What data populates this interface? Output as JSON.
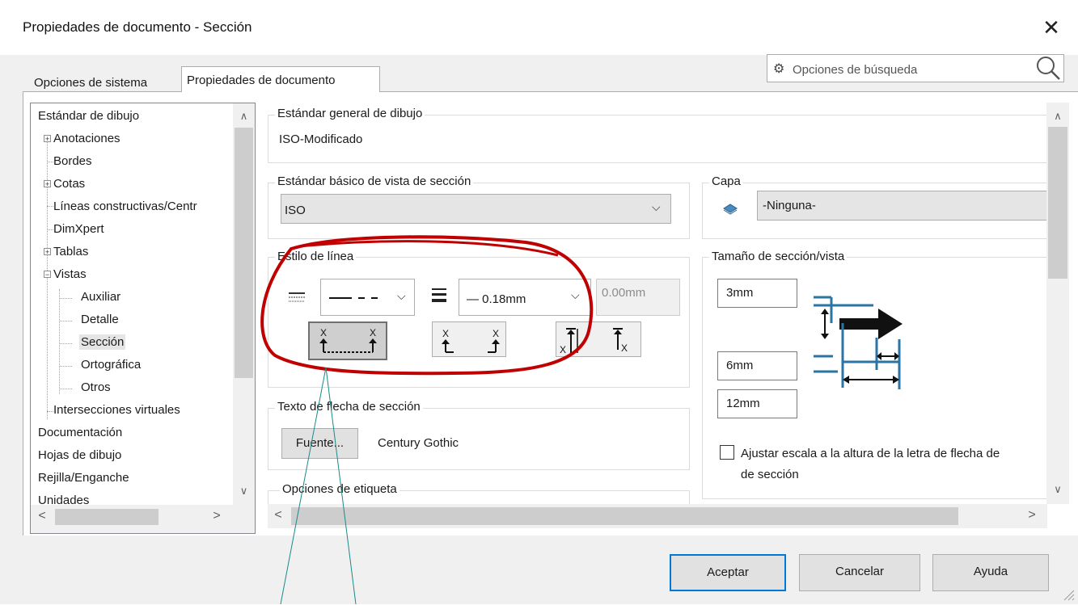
{
  "window": {
    "title": "Propiedades de documento - Sección",
    "close_label": "✕"
  },
  "search": {
    "placeholder": "Opciones de búsqueda"
  },
  "tabs": [
    {
      "label": "Opciones de sistema",
      "active": false
    },
    {
      "label": "Propiedades de documento",
      "active": true
    }
  ],
  "tree": {
    "items": [
      {
        "label": "Estándar de dibujo",
        "expander": ""
      },
      {
        "label": "Anotaciones",
        "expander": "+"
      },
      {
        "label": "Bordes",
        "expander": ""
      },
      {
        "label": "Cotas",
        "expander": "+"
      },
      {
        "label": "Líneas constructivas/Centr",
        "expander": ""
      },
      {
        "label": "DimXpert",
        "expander": ""
      },
      {
        "label": "Tablas",
        "expander": "+"
      },
      {
        "label": "Vistas",
        "expander": "−"
      },
      {
        "label": "Auxiliar",
        "expander": ""
      },
      {
        "label": "Detalle",
        "expander": ""
      },
      {
        "label": "Sección",
        "expander": "",
        "selected": true
      },
      {
        "label": "Ortográfica",
        "expander": ""
      },
      {
        "label": "Otros",
        "expander": ""
      },
      {
        "label": "Intersecciones virtuales",
        "expander": ""
      },
      {
        "label": "Documentación",
        "expander": ""
      },
      {
        "label": "Hojas de dibujo",
        "expander": ""
      },
      {
        "label": "Rejilla/Enganche",
        "expander": ""
      },
      {
        "label": "Unidades",
        "expander": ""
      }
    ]
  },
  "general": {
    "group_title": "Estándar general de dibujo",
    "value": "ISO-Modificado"
  },
  "section_standard": {
    "group_title": "Estándar básico de vista de sección",
    "value": "ISO"
  },
  "layer": {
    "group_title": "Capa",
    "value": "-Ninguna-"
  },
  "line_style": {
    "group_title": "Estilo de línea",
    "thickness": "— 0.18mm",
    "custom_thickness": "0.00mm"
  },
  "arrow_text": {
    "group_title": "Texto de flecha de sección",
    "font_button": "Fuente...",
    "font_name": "Century Gothic"
  },
  "label_options": {
    "group_title": "Opciones de etiqueta"
  },
  "size": {
    "group_title": "Tamaño de sección/vista",
    "values": [
      "3mm",
      "6mm",
      "12mm"
    ],
    "scale_checkbox": "Ajustar escala a la altura de la letra de flecha de",
    "scale_checkbox_line2": "de sección"
  },
  "buttons": {
    "ok": "Aceptar",
    "cancel": "Cancelar",
    "help": "Ayuda"
  },
  "colors": {
    "accent": "#0078d7",
    "annotation": "#c00000",
    "callout": "#1a8a8a",
    "diagram_blue": "#2a74a6"
  }
}
